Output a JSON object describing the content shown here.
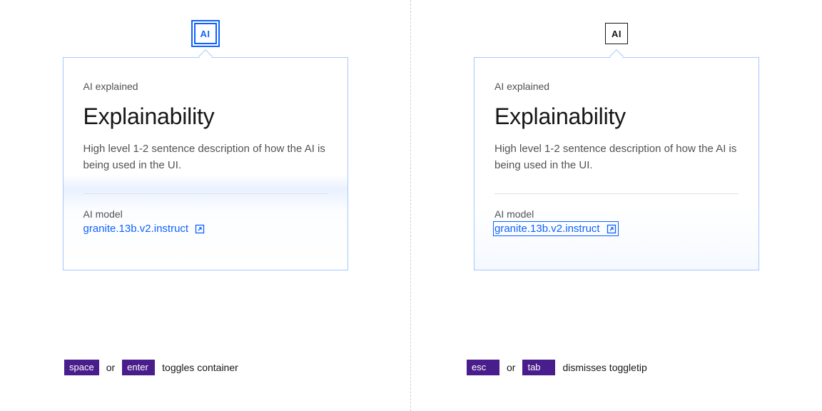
{
  "left": {
    "badge": "AI",
    "popover": {
      "eyebrow": "AI explained",
      "title": "Explainability",
      "description": "High level 1-2 sentence description of how the AI is being used in the UI.",
      "model_label": "AI model",
      "model_link_text": "granite.13b.v2.instruct"
    },
    "hint": {
      "key1": "space",
      "or": "or",
      "key2": "enter",
      "text": "toggles container"
    }
  },
  "right": {
    "badge": "AI",
    "popover": {
      "eyebrow": "AI explained",
      "title": "Explainability",
      "description": "High level 1-2 sentence description of how the AI is being used in the UI.",
      "model_label": "AI model",
      "model_link_text": "granite.13b.v2.instruct"
    },
    "hint": {
      "key1": "esc",
      "or": "or",
      "key2": "tab",
      "text": "dismisses toggletip"
    }
  }
}
